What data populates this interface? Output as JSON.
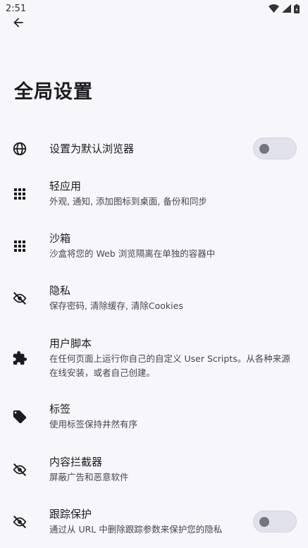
{
  "status_bar": {
    "time": "2:51",
    "icons": [
      "wifi-icon",
      "signal-icon",
      "battery-icon"
    ]
  },
  "header": {
    "back_icon": "arrow-left-icon",
    "title": "全局设置"
  },
  "colors": {
    "background": "#f7f7fb",
    "text": "#1c1b1f",
    "subtext": "#45464f",
    "toggle_track": "#e1e2ec",
    "toggle_knob": "#74757f"
  },
  "settings": [
    {
      "icon": "globe-icon",
      "title": "设置为默认浏览器",
      "subtitle": "",
      "toggle": {
        "on": false
      }
    },
    {
      "icon": "grid-icon",
      "title": "轻应用",
      "subtitle": "外观, 通知, 添加图标到桌面, 备份和同步"
    },
    {
      "icon": "grid-icon",
      "title": "沙箱",
      "subtitle": "沙盒将您的 Web 浏览隔离在单独的容器中"
    },
    {
      "icon": "eye-off-icon",
      "title": "隐私",
      "subtitle": "保存密码, 清除缓存, 清除Cookies"
    },
    {
      "icon": "puzzle-icon",
      "title": "用户脚本",
      "subtitle": "在任何页面上运行你自己的自定义 User Scripts。从各种来源在线安装，或者自己创建。"
    },
    {
      "icon": "tag-icon",
      "title": "标签",
      "subtitle": "使用标签保持井然有序"
    },
    {
      "icon": "eye-off-icon",
      "title": "内容拦截器",
      "subtitle": "屏蔽广告和恶意软件"
    },
    {
      "icon": "eye-off-icon",
      "title": "跟踪保护",
      "subtitle": "通过从 URL 中删除跟踪参数来保护您的隐私",
      "toggle": {
        "on": false
      }
    }
  ]
}
